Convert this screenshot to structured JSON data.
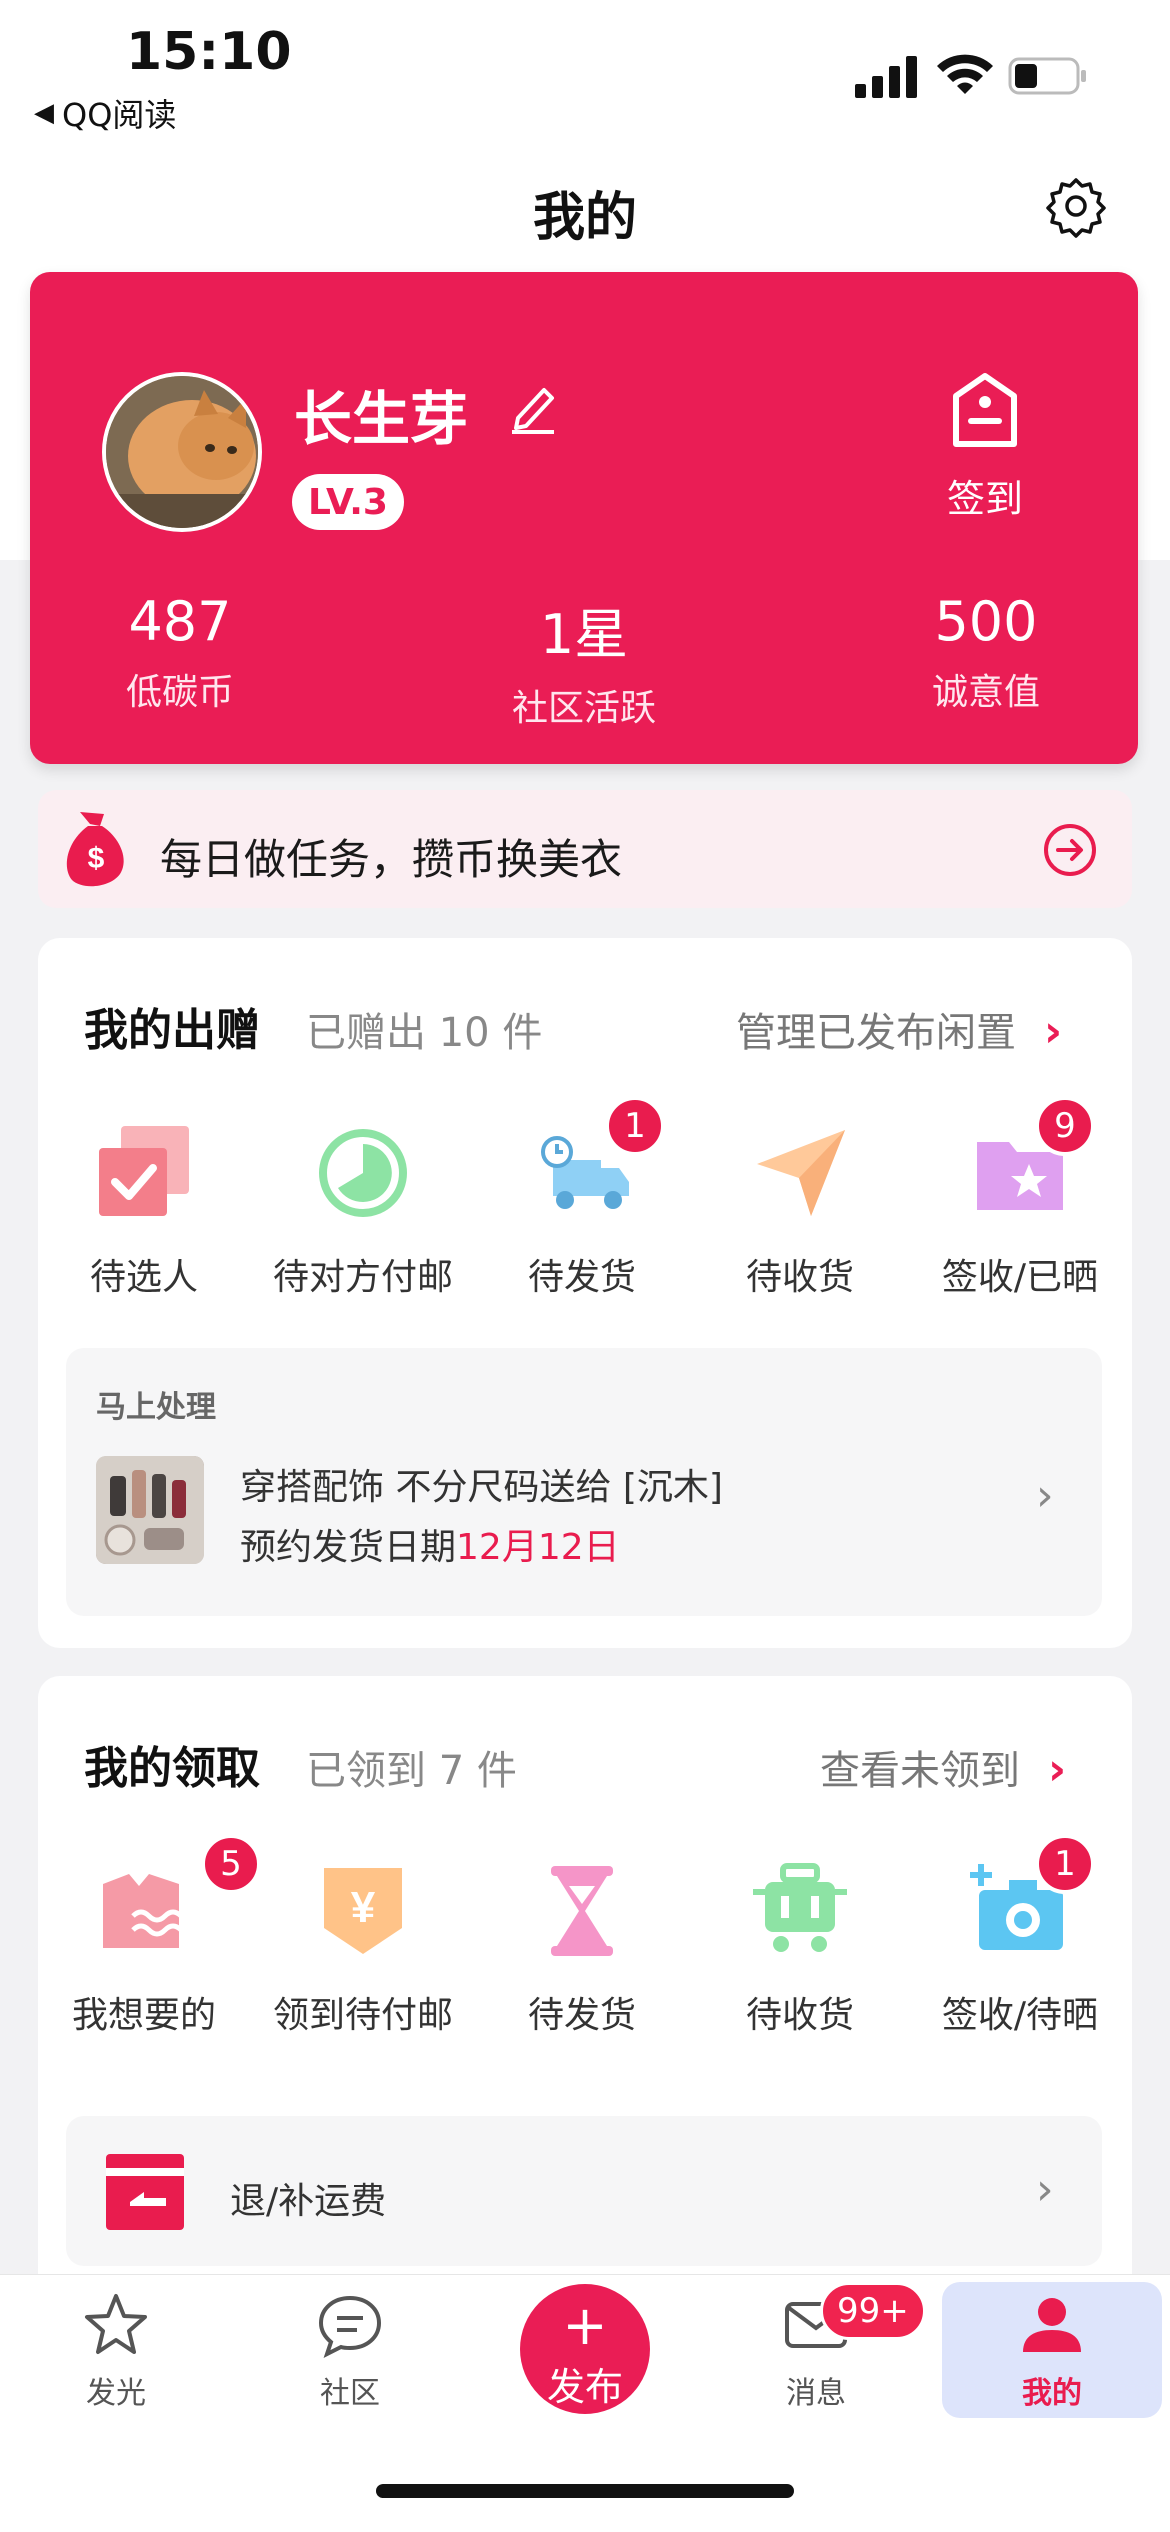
{
  "status_bar": {
    "time": "15:10",
    "back_app": "QQ阅读"
  },
  "header": {
    "title": "我的"
  },
  "profile": {
    "username": "长生芽",
    "level": "LV.3",
    "checkin_label": "签到",
    "stats": [
      {
        "value": "487",
        "label": "低碳币"
      },
      {
        "value": "1星",
        "label": "社区活跃"
      },
      {
        "value": "500",
        "label": "诚意值"
      }
    ]
  },
  "task_banner": {
    "text": "每日做任务，攒币换美衣"
  },
  "gifts": {
    "title": "我的出赠",
    "count": "已赠出 10 件",
    "link": "管理已发布闲置",
    "items": [
      {
        "label": "待选人",
        "icon": "checkbox-icon",
        "badge": ""
      },
      {
        "label": "待对方付邮",
        "icon": "pie-clock-icon",
        "badge": ""
      },
      {
        "label": "待发货",
        "icon": "delivery-truck-icon",
        "badge": "1"
      },
      {
        "label": "待收货",
        "icon": "paper-plane-icon",
        "badge": ""
      },
      {
        "label": "签收/已晒",
        "icon": "star-folder-icon",
        "badge": "9"
      }
    ],
    "pending": {
      "title": "马上处理",
      "item_title": "穿搭配饰 不分尺码送给 [沉木]",
      "date_prefix": "预约发货日期",
      "date": "12月12日"
    }
  },
  "receives": {
    "title": "我的领取",
    "count": "已领到 7 件",
    "link": "查看未领到",
    "items": [
      {
        "label": "我想要的",
        "icon": "wish-shirt-icon",
        "badge": "5"
      },
      {
        "label": "领到待付邮",
        "icon": "yen-tag-icon",
        "badge": ""
      },
      {
        "label": "待发货",
        "icon": "hourglass-icon",
        "badge": ""
      },
      {
        "label": "待收货",
        "icon": "cart-icon",
        "badge": ""
      },
      {
        "label": "签收/待晒",
        "icon": "camera-icon",
        "badge": "1"
      }
    ],
    "refund": {
      "text": "退/补运费"
    }
  },
  "bottom_nav": {
    "items": [
      {
        "label": "发光",
        "icon": "star-icon"
      },
      {
        "label": "社区",
        "icon": "chat-icon"
      },
      {
        "label": "发布",
        "icon": "plus-icon"
      },
      {
        "label": "消息",
        "icon": "mail-icon",
        "badge": "99+"
      },
      {
        "label": "我的",
        "icon": "user-icon"
      }
    ]
  },
  "colors": {
    "accent": "#ea1d55",
    "active_tab_bg": "#dde4fb"
  }
}
